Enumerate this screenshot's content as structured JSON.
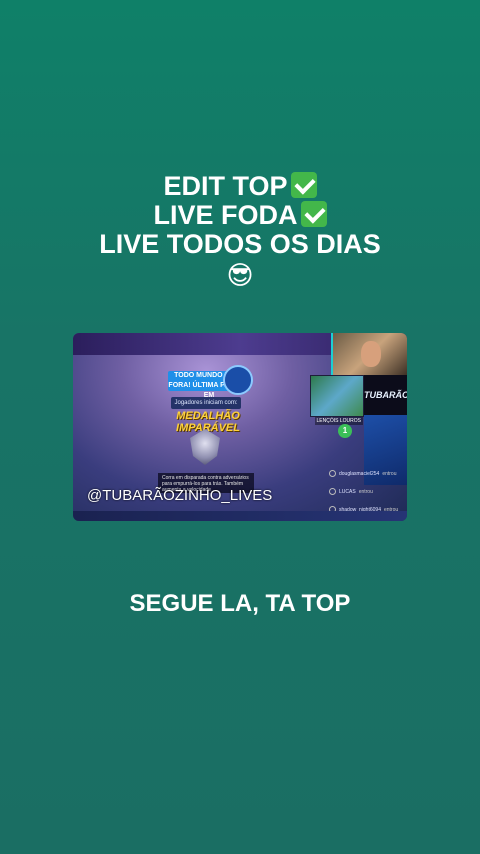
{
  "caption": {
    "line1": "EDIT TOP",
    "line2": "LIVE FODA",
    "line3": "LIVE TODOS OS DIAS",
    "emoji": "😎"
  },
  "video": {
    "banner_text": "TODO MUNDO PARA FORA! ÚLTIMA PARADA EM",
    "sub_label": "Jogadores iniciam com:",
    "medal_title": "MEDALHÃO IMPARÁVEL",
    "objective_text": "Corra em disparada contra adversários para empurrá-los para trás. Também aumenta a velocidade",
    "watermark": "@TUBARÃOZINHO_LIVES",
    "side_logo": "TUBARÃO",
    "location_label": "LENÇÓIS LOUROS",
    "circle_number": "1",
    "feed": [
      {
        "name": "douglasmaciel254",
        "action": "entrou"
      },
      {
        "name": "LUCAS",
        "action": "entrou"
      },
      {
        "name": "shadow_night6094",
        "action": "entrou"
      }
    ]
  },
  "footer": {
    "text": "SEGUE LA, TA TOP"
  },
  "colors": {
    "background": "#187466",
    "text": "#ffffff",
    "check": "#43b74a"
  }
}
